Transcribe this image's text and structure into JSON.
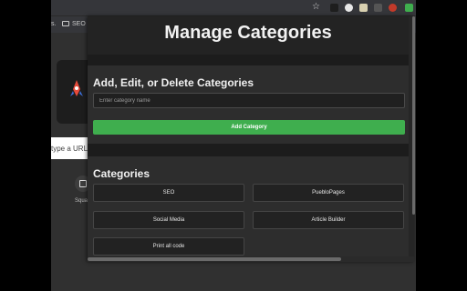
{
  "bookmarks": {
    "first": "s.",
    "second": "SEO S"
  },
  "background": {
    "search_placeholder": "type a URL",
    "shortcut_label": "Squa"
  },
  "popup": {
    "title": "Manage Categories",
    "edit_section_title": "Add, Edit, or Delete Categories",
    "input_placeholder": "Enter category name",
    "add_button": "Add Category",
    "list_title": "Categories",
    "categories": [
      "SEO",
      "PuebloPages",
      "Social Media",
      "Article Builder",
      "Print all code"
    ]
  },
  "colors": {
    "accent": "#3fae4e",
    "popup_bg": "#262626",
    "card_bg": "#2d2d2d"
  },
  "icons": [
    "star-icon",
    "extension-icon",
    "rocket-icon",
    "folder-icon"
  ]
}
